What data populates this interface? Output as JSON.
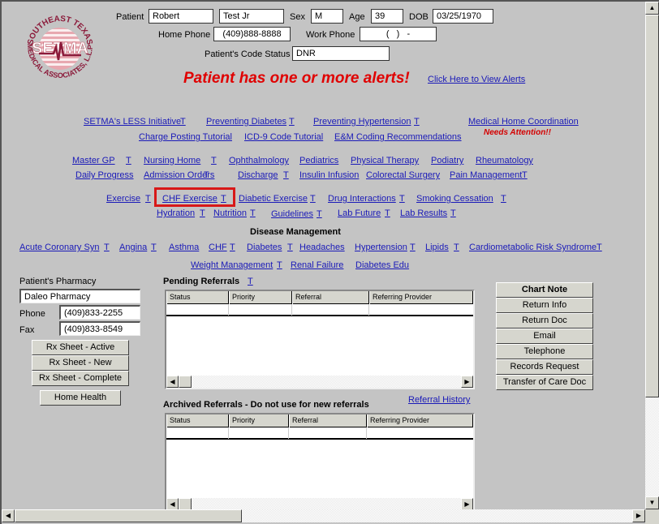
{
  "logo": {
    "top_text": "SOUTHEAST TEXAS",
    "bottom_text": "MEDICAL ASSOCIATES, L.L.P.",
    "center_text": "SETMA",
    "color": "#8b1a3a"
  },
  "patient": {
    "label": "Patient",
    "first_name": "Robert",
    "last_name": "Test Jr",
    "sex_label": "Sex",
    "sex": "M",
    "age_label": "Age",
    "age": "39",
    "dob_label": "DOB",
    "dob": "03/25/1970",
    "home_phone_label": "Home Phone",
    "home_phone": "(409)888-8888",
    "work_phone_label": "Work Phone",
    "work_phone": "(   )   -",
    "code_status_label": "Patient's Code Status",
    "code_status": "DNR"
  },
  "alert": {
    "message": "Patient has one or more alerts!",
    "link": "Click Here to View Alerts",
    "color": "#e00000"
  },
  "top_links": {
    "less_initiative": "SETMA's LESS Initiative",
    "preventing_diabetes": "Preventing Diabetes",
    "preventing_hypertension": "Preventing Hypertension",
    "medical_home": "Medical Home Coordination",
    "needs_attention": "Needs Attention!!",
    "charge_posting": "Charge Posting Tutorial",
    "icd9": "ICD-9 Code Tutorial",
    "em_coding": "E&M Coding Recommendations",
    "t": "T"
  },
  "specialty_links": {
    "master_gp": "Master GP",
    "nursing_home": "Nursing Home",
    "ophthalmology": "Ophthalmology",
    "pediatrics": "Pediatrics",
    "physical_therapy": "Physical Therapy",
    "podiatry": "Podiatry",
    "rheumatology": "Rheumatology",
    "daily_progress": "Daily Progress",
    "admission_orders": "Admission Orders",
    "discharge": "Discharge",
    "insulin_infusion": "Insulin Infusion",
    "colorectal_surgery": "Colorectal Surgery",
    "pain_management": "Pain Management"
  },
  "education_links": {
    "exercise": "Exercise",
    "chf_exercise": "CHF Exercise",
    "diabetic_exercise": "Diabetic Exercise",
    "drug_interactions": "Drug Interactions",
    "smoking_cessation": "Smoking Cessation",
    "hydration": "Hydration",
    "nutrition": "Nutrition",
    "guidelines": "Guidelines",
    "lab_future": "Lab Future",
    "lab_results": "Lab Results"
  },
  "disease_management": {
    "title": "Disease Management",
    "acute_coronary": "Acute Coronary Syn",
    "angina": "Angina",
    "asthma": "Asthma",
    "chf": "CHF",
    "diabetes": "Diabetes",
    "headaches": "Headaches",
    "hypertension": "Hypertension",
    "lipids": "Lipids",
    "cardiometabolic": "Cardiometabolic Risk Syndrome",
    "weight_management": "Weight Management",
    "renal_failure": "Renal Failure",
    "diabetes_edu": "Diabetes Edu"
  },
  "pharmacy": {
    "label": "Patient's Pharmacy",
    "name": "Daleo Pharmacy",
    "phone_label": "Phone",
    "phone": "(409)833-2255",
    "fax_label": "Fax",
    "fax": "(409)833-8549",
    "buttons": [
      "Rx Sheet - Active",
      "Rx Sheet - New",
      "Rx Sheet - Complete"
    ],
    "home_health": "Home Health"
  },
  "pending_referrals": {
    "title": "Pending Referrals",
    "t": "T",
    "columns": [
      "Status",
      "Priority",
      "Referral",
      "Referring Provider"
    ],
    "rows": []
  },
  "archived_referrals": {
    "title": "Archived Referrals - Do not use for new referrals",
    "history_link": "Referral History",
    "columns": [
      "Status",
      "Priority",
      "Referral",
      "Referring Provider"
    ],
    "rows": []
  },
  "right_buttons": {
    "chart_note": "Chart Note",
    "items": [
      "Return Info",
      "Return Doc",
      "Email",
      "Telephone",
      "Records Request",
      "Transfer of Care Doc"
    ]
  },
  "scroll_glyphs": {
    "left": "◀",
    "right": "▶",
    "up": "▲",
    "down": "▼"
  }
}
